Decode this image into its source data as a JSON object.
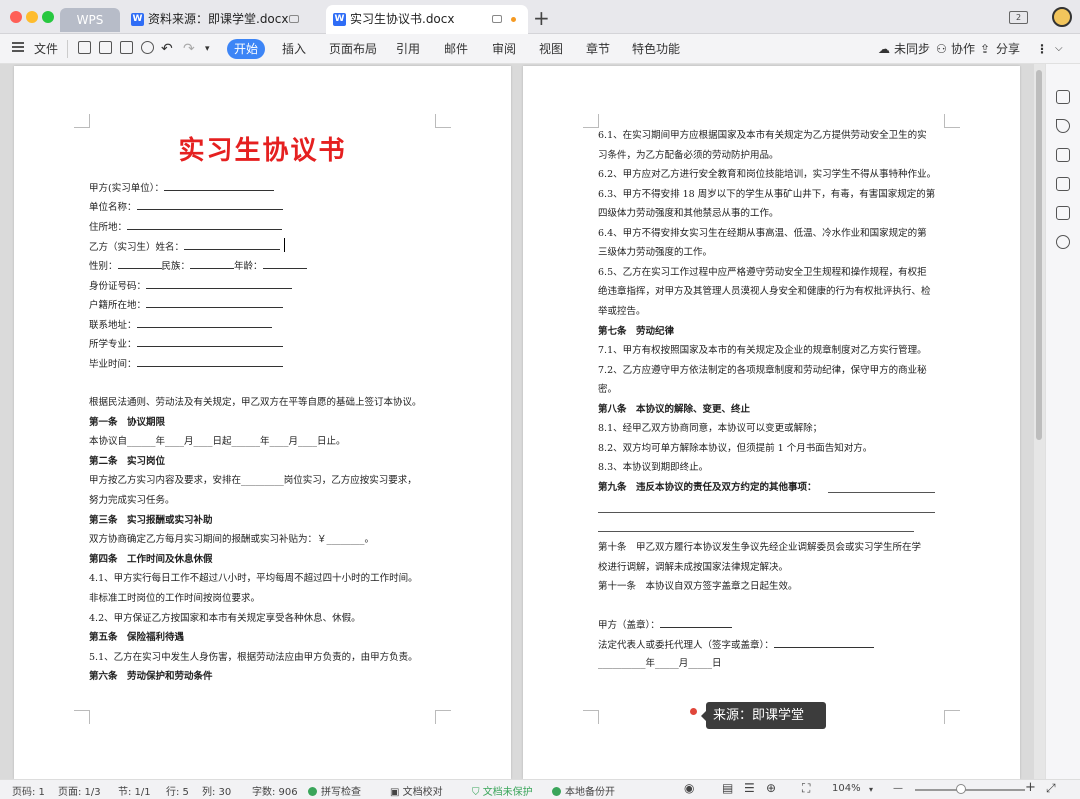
{
  "titlebar": {
    "wps_tab": "WPS",
    "tabs": [
      {
        "label": "资料来源：即课学堂.docx"
      },
      {
        "label": "实习生协议书.docx"
      }
    ],
    "plus": "+",
    "box_label": "2"
  },
  "toolbar": {
    "file": "文件",
    "menus": [
      "开始",
      "插入",
      "页面布局",
      "引用",
      "邮件",
      "审阅",
      "视图",
      "章节",
      "特色功能"
    ],
    "unsynced": "未同步",
    "collab": "协作",
    "share": "分享"
  },
  "left_page": {
    "title": "实习生协议书",
    "fields": [
      "甲方(实习单位）：",
      "单位名称：",
      "住所地：",
      "乙方（实习生）姓名：",
      "性别：",
      "身份证号码：",
      "户籍所在地：",
      "联系地址：",
      "所学专业：",
      "毕业时间："
    ],
    "gender_parts": [
      "民族：",
      "年龄："
    ],
    "lines": [
      {
        "t": "根据民法通则、劳动法及有关规定，甲乙双方在平等自愿的基础上签订本协议。",
        "b": false
      },
      {
        "t": "第一条　协议期限",
        "b": true
      },
      {
        "t": "本协议自______年____月____日起______年____月____日止。",
        "b": false
      },
      {
        "t": "第二条　实习岗位",
        "b": true
      },
      {
        "t": "甲方按乙方实习内容及要求，安排在_________岗位实习，乙方应按实习要求，",
        "b": false
      },
      {
        "t": "努力完成实习任务。",
        "b": false
      },
      {
        "t": "第三条　实习报酬或实习补助",
        "b": true
      },
      {
        "t": "双方协商确定乙方每月实习期间的报酬或实习补贴为：￥________。",
        "b": false
      },
      {
        "t": "第四条　工作时间及休息休假",
        "b": true
      },
      {
        "t": "4.1、甲方实行每日工作不超过八小时，平均每周不超过四十小时的工作时间。",
        "b": false
      },
      {
        "t": "非标准工时岗位的工作时间按岗位要求。",
        "b": false
      },
      {
        "t": "4.2、甲方保证乙方按国家和本市有关规定享受各种休息、休假。",
        "b": false
      },
      {
        "t": "第五条　保险福利待遇",
        "b": true
      },
      {
        "t": "5.1、乙方在实习中发生人身伤害，根据劳动法应由甲方负责的，由甲方负责。",
        "b": false
      },
      {
        "t": "第六条　劳动保护和劳动条件",
        "b": true
      }
    ]
  },
  "right_page": {
    "lines": [
      {
        "t": "6.1、在实习期间甲方应根据国家及本市有关规定为乙方提供劳动安全卫生的实",
        "b": false
      },
      {
        "t": "习条件，为乙方配备必须的劳动防护用品。",
        "b": false
      },
      {
        "t": "6.2、甲方应对乙方进行安全教育和岗位技能培训，实习学生不得从事特种作业。",
        "b": false
      },
      {
        "t": "6.3、甲方不得安排 18 周岁以下的学生从事矿山井下，有毒，有害国家规定的第",
        "b": false
      },
      {
        "t": "四级体力劳动强度和其他禁忌从事的工作。",
        "b": false
      },
      {
        "t": "6.4、甲方不得安排女实习生在经期从事高温、低温、冷水作业和国家规定的第",
        "b": false
      },
      {
        "t": "三级体力劳动强度的工作。",
        "b": false
      },
      {
        "t": "6.5、乙方在实习工作过程中应严格遵守劳动安全卫生规程和操作规程，有权拒",
        "b": false
      },
      {
        "t": "绝违章指挥，对甲方及其管理人员漠视人身安全和健康的行为有权批评执行、检",
        "b": false
      },
      {
        "t": "举或控告。",
        "b": false
      },
      {
        "t": "第七条　劳动纪律",
        "b": true
      },
      {
        "t": "7.1、甲方有权按照国家及本市的有关规定及企业的规章制度对乙方实行管理。",
        "b": false
      },
      {
        "t": "7.2、乙方应遵守甲方依法制定的各项规章制度和劳动纪律，保守甲方的商业秘",
        "b": false
      },
      {
        "t": "密。",
        "b": false
      },
      {
        "t": "第八条　本协议的解除、变更、终止",
        "b": true
      },
      {
        "t": "8.1、经甲乙双方协商同意，本协议可以变更或解除；",
        "b": false
      },
      {
        "t": "8.2、双方均可单方解除本协议，但须提前 1 个月书面告知对方。",
        "b": false
      },
      {
        "t": "8.3、本协议到期即终止。",
        "b": false
      },
      {
        "t": "第九条　违反本协议的责任及双方约定的其他事项：",
        "b": true
      }
    ],
    "lines2": [
      {
        "t": "第十条　甲乙双方履行本协议发生争议先经企业调解委员会或实习学生所在学",
        "b": false
      },
      {
        "t": "校进行调解，调解未成按国家法律规定解决。",
        "b": false
      },
      {
        "t": "第十一条　本协议自双方签字盖章之日起生效。",
        "b": false
      }
    ],
    "sign_a": "甲方（盖章）：",
    "sign_rep": "法定代表人或委托代理人（签字或盖章）：",
    "date_line": "__________年_____月_____日"
  },
  "overlay": {
    "source": "来源：即课学堂"
  },
  "statusbar": {
    "page_no": "页码: 1",
    "pages": "页面: 1/3",
    "section": "节: 1/1",
    "row": "行: 5",
    "col": "列: 30",
    "words": "字数: 906",
    "spell": "拼写检查",
    "proof": "文档校对",
    "unprotected": "文档未保护",
    "backup": "本地备份开",
    "zoom": "104%",
    "zoom_minus": "—",
    "zoom_plus": "+"
  }
}
